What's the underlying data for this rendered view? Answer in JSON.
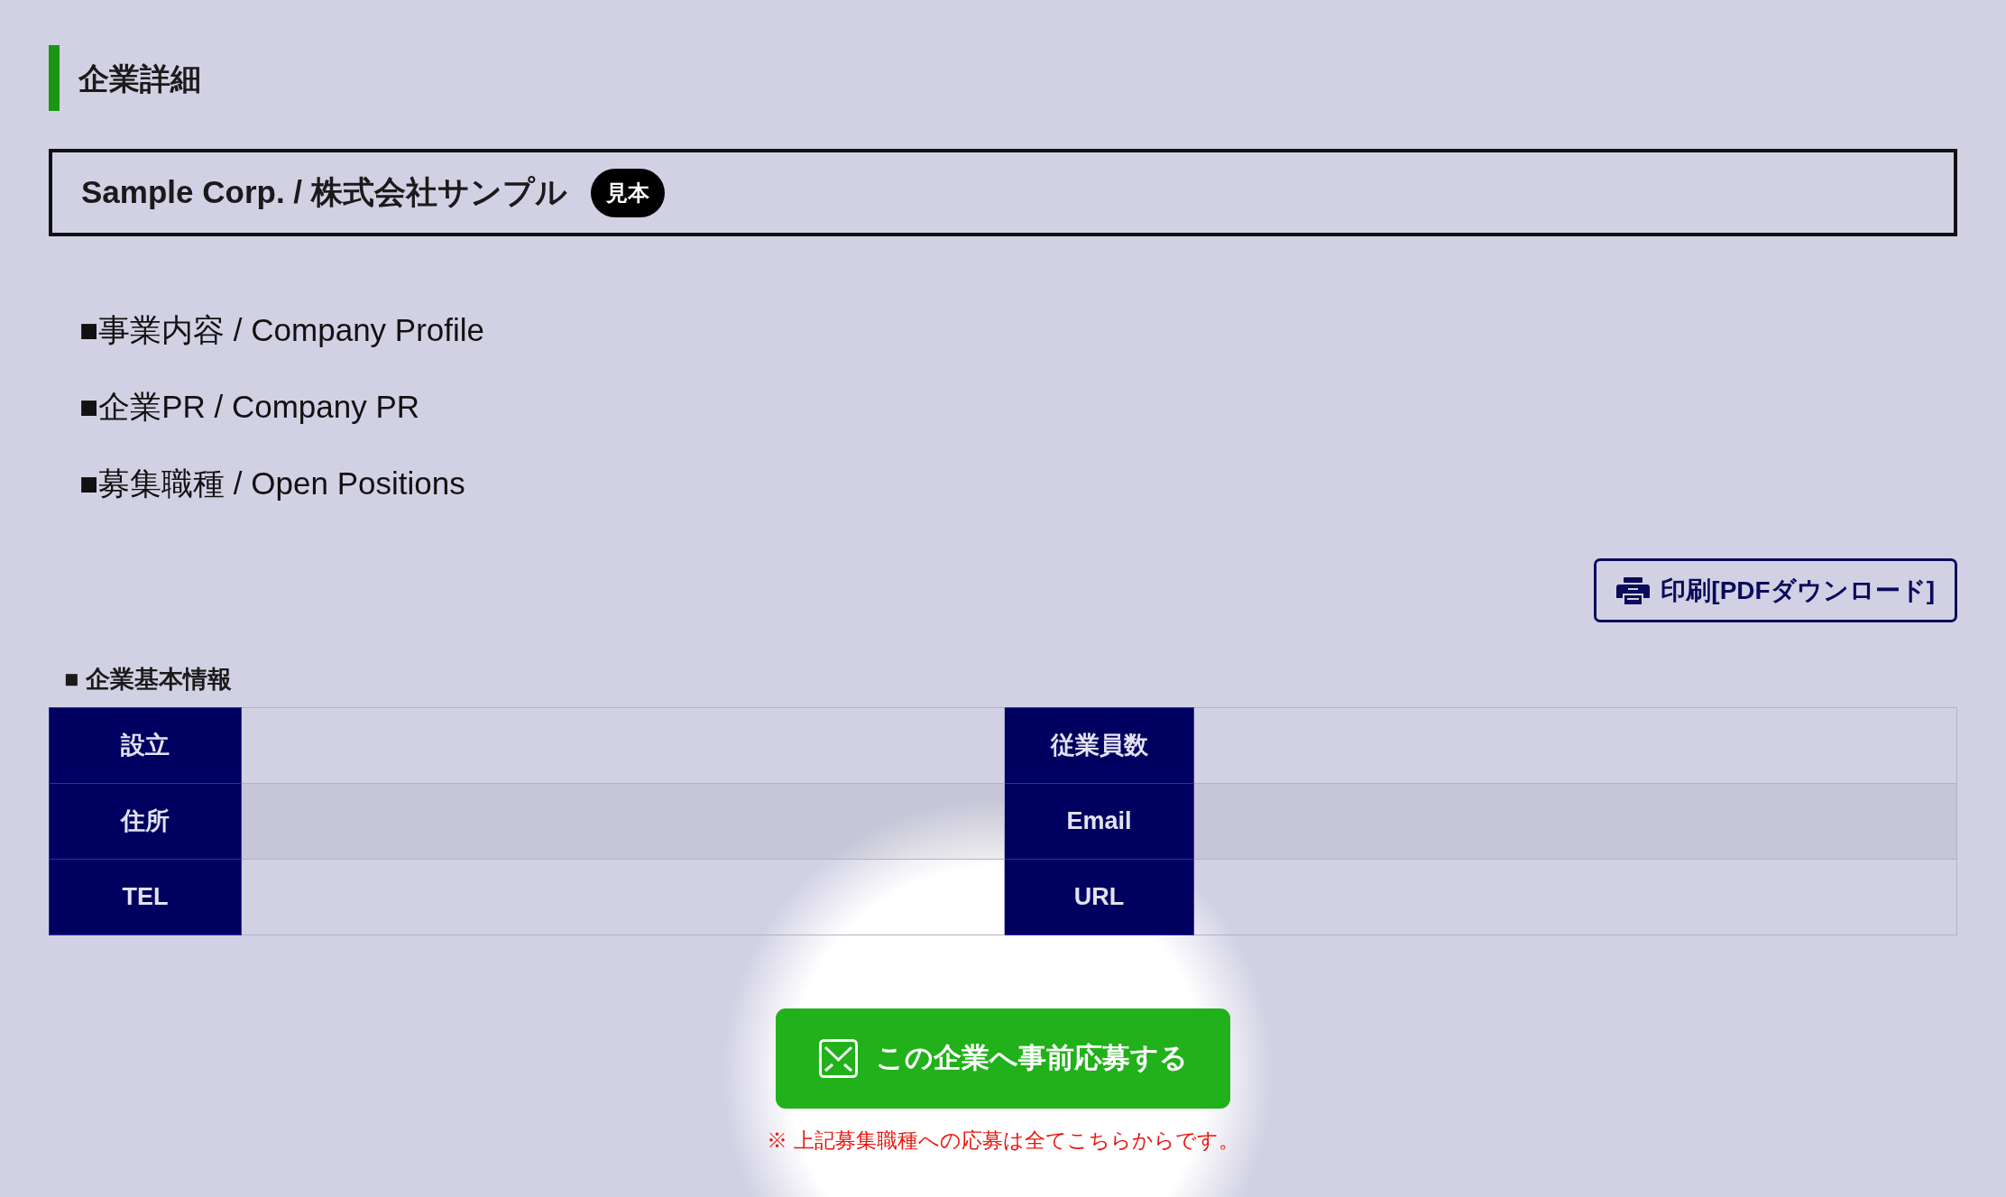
{
  "page_title": "企業詳細",
  "company": {
    "name": "Sample Corp. / 株式会社サンプル",
    "badge": "見本"
  },
  "sections": [
    {
      "label": "■事業内容 / Company Profile"
    },
    {
      "label": "■企業PR / Company PR"
    },
    {
      "label": "■募集職種 / Open Positions"
    }
  ],
  "print_button": {
    "label": "印刷[PDFダウンロード]"
  },
  "basic_info": {
    "heading": "■ 企業基本情報",
    "rows": [
      {
        "labels": [
          "設立",
          "従業員数"
        ]
      },
      {
        "labels": [
          "住所",
          "Email"
        ]
      },
      {
        "labels": [
          "TEL",
          "URL"
        ]
      }
    ]
  },
  "apply_button": {
    "label": "この企業へ事前応募する"
  },
  "note": "※ 上記募集職種への応募は全てこちらからです。"
}
